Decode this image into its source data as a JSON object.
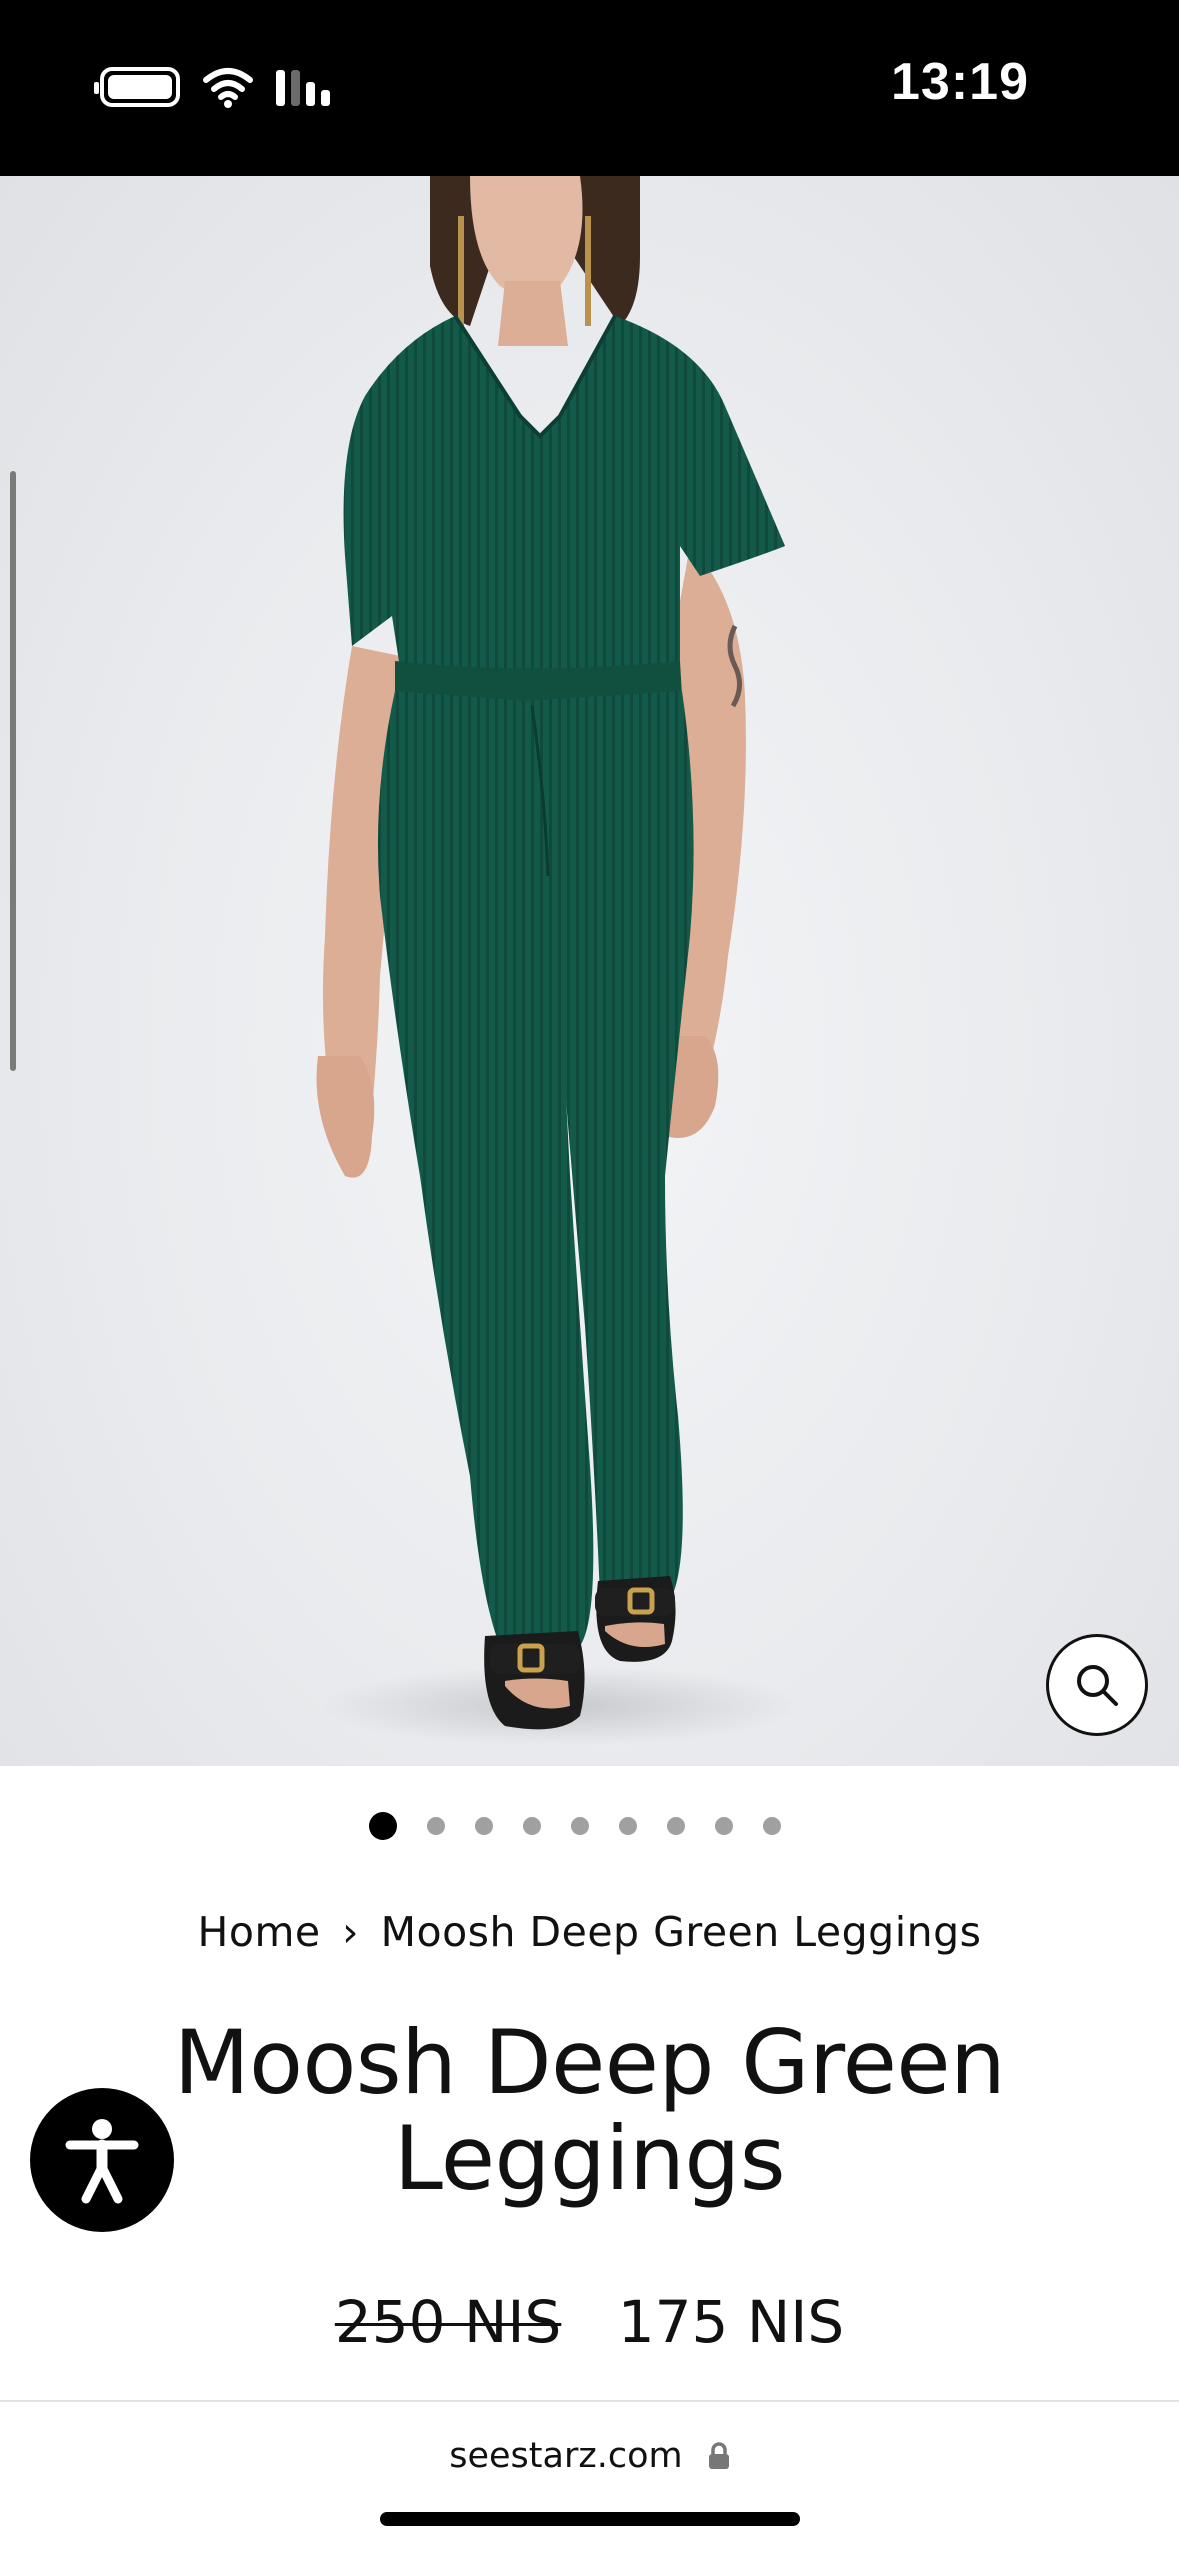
{
  "status_bar": {
    "time": "13:19",
    "icons": [
      "battery-icon",
      "wifi-icon",
      "cellular-signal-icon"
    ]
  },
  "product_image": {
    "alt": "Model wearing deep green ribbed top and flared leggings",
    "colors": {
      "garment": "#145a4a",
      "background": "#eceef1"
    },
    "zoom_icon": "search-icon"
  },
  "carousel": {
    "total": 9,
    "active_index": 0
  },
  "breadcrumb": {
    "home": "Home",
    "separator": "›",
    "current": "Moosh Deep Green Leggings"
  },
  "product": {
    "title": "Moosh Deep Green Leggings",
    "price_old": "250 NIS",
    "price_new": "175 NIS"
  },
  "accessibility": {
    "icon": "accessibility-icon"
  },
  "browser": {
    "domain": "seestarz.com",
    "lock_icon": "lock-icon"
  }
}
